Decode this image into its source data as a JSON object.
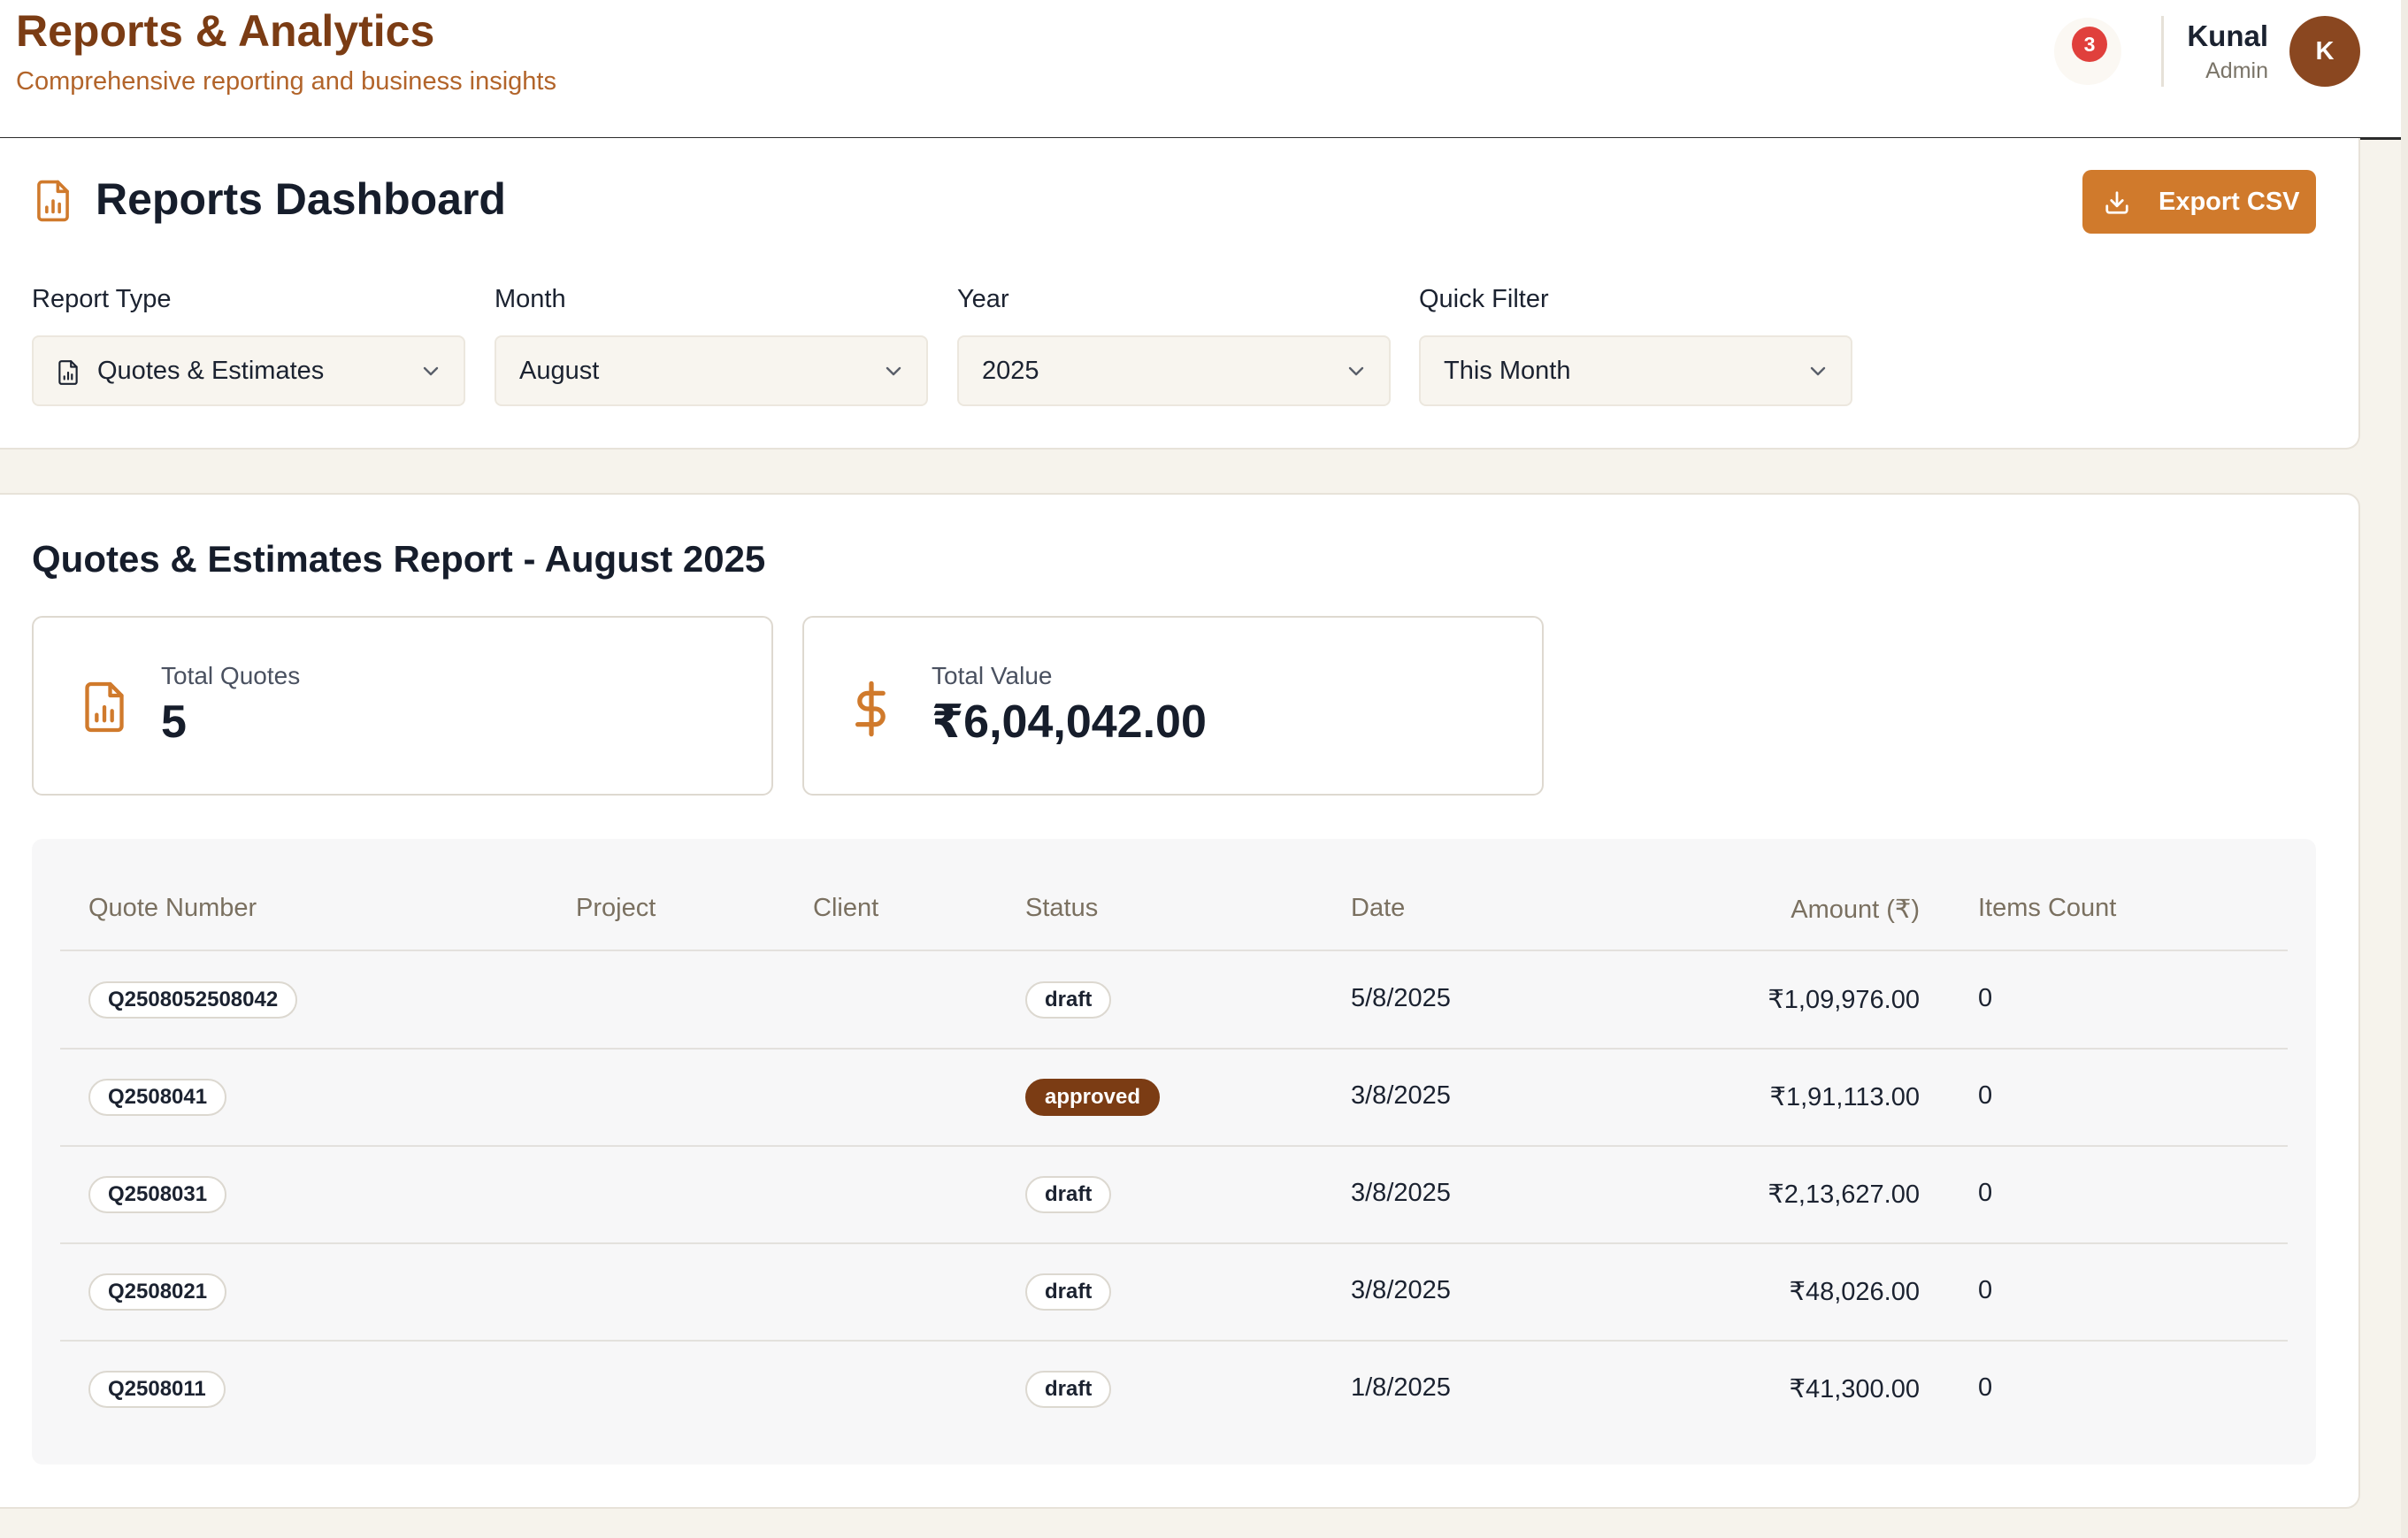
{
  "header": {
    "title": "Reports & Analytics",
    "subtitle": "Comprehensive reporting and business insights",
    "notification_count": "3",
    "user": {
      "name": "Kunal",
      "role": "Admin",
      "initial": "K"
    }
  },
  "dashboard": {
    "title": "Reports Dashboard",
    "export_label": "Export CSV",
    "filters": [
      {
        "label": "Report Type",
        "value": "Quotes & Estimates",
        "icon": "file-chart-icon"
      },
      {
        "label": "Month",
        "value": "August"
      },
      {
        "label": "Year",
        "value": "2025"
      },
      {
        "label": "Quick Filter",
        "value": "This Month"
      }
    ]
  },
  "report": {
    "title": "Quotes & Estimates Report - August 2025",
    "stats": [
      {
        "label": "Total Quotes",
        "value": "5",
        "icon": "file-chart-icon"
      },
      {
        "label": "Total Value",
        "value": "₹6,04,042.00",
        "icon": "dollar-icon"
      }
    ],
    "columns": [
      "Quote Number",
      "Project",
      "Client",
      "Status",
      "Date",
      "Amount (₹)",
      "Items Count"
    ],
    "rows": [
      {
        "quote": "Q2508052508042",
        "project": "",
        "client": "",
        "status": "draft",
        "date": "5/8/2025",
        "amount": "₹1,09,976.00",
        "items": "0"
      },
      {
        "quote": "Q2508041",
        "project": "",
        "client": "",
        "status": "approved",
        "date": "3/8/2025",
        "amount": "₹1,91,113.00",
        "items": "0"
      },
      {
        "quote": "Q2508031",
        "project": "",
        "client": "",
        "status": "draft",
        "date": "3/8/2025",
        "amount": "₹2,13,627.00",
        "items": "0"
      },
      {
        "quote": "Q2508021",
        "project": "",
        "client": "",
        "status": "draft",
        "date": "3/8/2025",
        "amount": "₹48,026.00",
        "items": "0"
      },
      {
        "quote": "Q2508011",
        "project": "",
        "client": "",
        "status": "draft",
        "date": "1/8/2025",
        "amount": "₹41,300.00",
        "items": "0"
      }
    ]
  },
  "colors": {
    "brand": "#7b3c14",
    "accent": "#d07a2c",
    "subtitle": "#b2642a",
    "badge": "#e0403c"
  }
}
